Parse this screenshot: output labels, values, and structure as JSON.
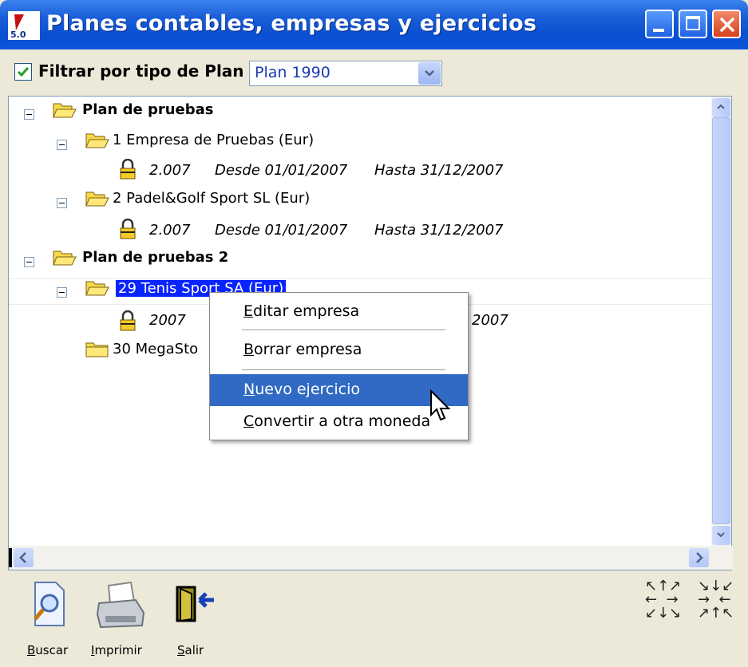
{
  "window": {
    "title": "Planes contables, empresas y ejercicios",
    "app_icon_version": "5.0"
  },
  "filter": {
    "checkbox_label": "Filtrar por tipo de Plan",
    "checked": true,
    "plan_select_value": "Plan 1990"
  },
  "tree": {
    "plan1": {
      "label": "Plan de pruebas",
      "company1": {
        "label": "1 Empresa de Pruebas (Eur)",
        "exercise": {
          "year": "2.007",
          "from": "Desde 01/01/2007",
          "to": "Hasta 31/12/2007"
        }
      },
      "company2": {
        "label": "2 Padel&Golf Sport SL (Eur)",
        "exercise": {
          "year": "2.007",
          "from": "Desde 01/01/2007",
          "to": "Hasta 31/12/2007"
        }
      }
    },
    "plan2": {
      "label": "Plan de pruebas 2",
      "company1": {
        "label": "29 Tenis Sport SA (Eur)",
        "exercise": {
          "year_visible": "2007",
          "to_tail_visible": "2007"
        }
      },
      "company2": {
        "label_visible": "30 MegaSto"
      }
    }
  },
  "context_menu": {
    "items": [
      {
        "mnemonic": "E",
        "rest": "ditar empresa"
      },
      {
        "mnemonic": "B",
        "rest": "orrar empresa"
      },
      {
        "mnemonic": "N",
        "rest": "uevo ejercicio"
      },
      {
        "mnemonic": "C",
        "rest": "onvertir a otra moneda"
      }
    ],
    "highlighted_index": 2
  },
  "toolbar": {
    "search": {
      "mnemonic": "B",
      "rest": "uscar",
      "icon": "search-document-icon"
    },
    "print": {
      "mnemonic": "I",
      "rest": "mprimir",
      "icon": "printer-icon"
    },
    "exit": {
      "mnemonic": "S",
      "rest": "alir",
      "icon": "exit-door-icon"
    },
    "expand_icon": "expand-all-icon",
    "collapse_icon": "collapse-all-icon"
  },
  "colors": {
    "titlebar": "#0a4fd0",
    "selection": "#0a24ff",
    "menu_highlight": "#316ac5",
    "window_bg": "#ece9d8"
  }
}
